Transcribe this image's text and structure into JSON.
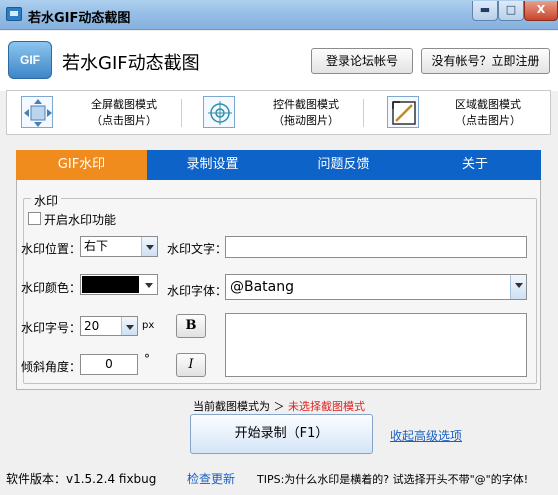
{
  "window": {
    "title": "若水GIF动态截图",
    "min_label": "▬",
    "max_label": "□",
    "close_label": "X"
  },
  "header": {
    "logo_text": "GIF",
    "app_title": "若水GIF动态截图",
    "login_label": "登录论坛帐号",
    "register_label": "没有帐号？立即注册"
  },
  "modes": [
    {
      "title": "全屏截图模式",
      "hint": "（点击图片）"
    },
    {
      "title": "控件截图模式",
      "hint": "（拖动图片）"
    },
    {
      "title": "区域截图模式",
      "hint": "（点击图片）"
    }
  ],
  "tabs": [
    "GIF水印",
    "录制设置",
    "问题反馈",
    "关于"
  ],
  "watermark": {
    "group_title": "水印",
    "enable_label": "开启水印功能",
    "position_label": "水印位置：",
    "position_value": "右下",
    "text_label": "水印文字：",
    "text_value": "",
    "color_label": "水印颜色：",
    "color_value": "#000000",
    "font_label": "水印字体：",
    "font_value": "@Batang",
    "size_label": "水印字号：",
    "size_value": "20",
    "size_unit": "px",
    "bold_label": "B",
    "angle_label": "倾斜角度：",
    "angle_value": "0",
    "angle_unit": "°",
    "italic_label": "I"
  },
  "status": {
    "prefix": "当前截图模式为  ＞",
    "mode": "未选择截图模式"
  },
  "actions": {
    "start_label": "开始录制（F1）",
    "advanced_label": "收起高级选项"
  },
  "footer": {
    "version": "软件版本：v1.5.2.4 fixbug",
    "check_update": "检查更新",
    "tips": "TIPS:为什么水印是横着的? 试选择开头不带\"@\"的字体!"
  },
  "colors": {
    "tab_active": "#f08b1e",
    "tab_bar": "#0e63c9",
    "status_mode": "#e02020",
    "link": "#1a5fc2"
  }
}
